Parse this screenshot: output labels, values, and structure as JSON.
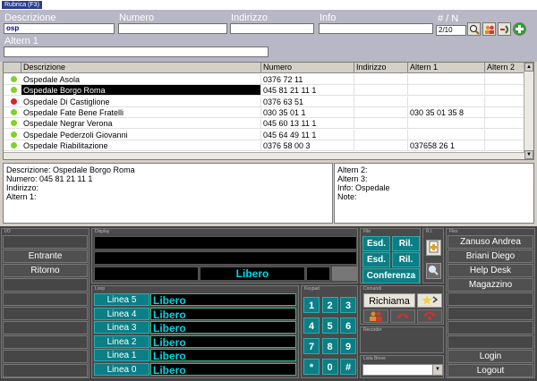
{
  "window": {
    "title": "Rubrica (F3)"
  },
  "search": {
    "desc_label": "Descrizione",
    "desc_value": "osp",
    "numero_label": "Numero",
    "indirizzo_label": "Indirizzo",
    "info_label": "Info",
    "altern_label": "Altern 1",
    "count_label": "# / N",
    "count_value": "2/10"
  },
  "grid": {
    "columns": [
      "Descrizione",
      "Numero",
      "Indirizzo",
      "Altern 1",
      "Altern 2"
    ],
    "rows": [
      {
        "status": "green",
        "desc": "Ospedale Asola",
        "num": "0376 72 11",
        "ind": "",
        "alt1": "",
        "alt2": ""
      },
      {
        "status": "green",
        "desc": "Ospedale Borgo Roma",
        "num": "045 81 21 11 1",
        "ind": "",
        "alt1": "",
        "alt2": ""
      },
      {
        "status": "red",
        "desc": "Ospedale Di Castiglione",
        "num": "0376 63 51",
        "ind": "",
        "alt1": "",
        "alt2": ""
      },
      {
        "status": "green",
        "desc": "Ospedale Fate Bene Fratelli",
        "num": "030 35 01 1",
        "ind": "",
        "alt1": "030 35 01 35 8",
        "alt2": ""
      },
      {
        "status": "green",
        "desc": "Ospedale Negrar Verona",
        "num": "045 60 13 11 1",
        "ind": "",
        "alt1": "",
        "alt2": ""
      },
      {
        "status": "green",
        "desc": "Ospedale Pederzoli Giovanni",
        "num": "045 64 49 11 1",
        "ind": "",
        "alt1": "",
        "alt2": ""
      },
      {
        "status": "green",
        "desc": "Ospedale Riabilitazione",
        "num": "0376 58 00 3",
        "ind": "",
        "alt1": "037658 26 1",
        "alt2": ""
      }
    ]
  },
  "detail": {
    "left": [
      "Descrizione: Ospedale Borgo Roma",
      "Numero: 045 81 21 11 1",
      "Indirizzo:",
      "Altern 1:"
    ],
    "right": [
      "Altern 2:",
      "Altern 3:",
      "Info: Ospedale",
      "Note:"
    ]
  },
  "panel": {
    "io_title": "I/O",
    "display_title": "Display",
    "file_title": "File",
    "ri_title": "R.I.",
    "flex_title": "Flex",
    "loop_title": "Loop",
    "keypad_title": "Keypad",
    "comandi_title": "Comandi",
    "recorder_title": "Recorder",
    "lista_title": "Lista Breve",
    "io_buttons": [
      "",
      "Entrante",
      "Ritorno",
      "",
      "",
      "",
      "",
      "",
      "",
      ""
    ],
    "display_status": "Libero",
    "file_buttons": {
      "esd1": "Esd.",
      "ril1": "Ril.",
      "esd2": "Esd.",
      "ril2": "Ril.",
      "conferenza": "Conferenza"
    },
    "flex_buttons": [
      "Zanuso Andrea",
      "Briani Diego",
      "Help Desk",
      "Magazzino",
      "",
      "",
      "",
      "",
      "Login",
      "Logout"
    ],
    "lines": [
      {
        "label": "Linea 5",
        "status": "Libero"
      },
      {
        "label": "Linea 4",
        "status": "Libero"
      },
      {
        "label": "Linea 3",
        "status": "Libero"
      },
      {
        "label": "Linea 2",
        "status": "Libero"
      },
      {
        "label": "Linea 1",
        "status": "Libero"
      },
      {
        "label": "Linea 0",
        "status": "Libero"
      }
    ],
    "keys": [
      "1",
      "2",
      "3",
      "4",
      "5",
      "6",
      "7",
      "8",
      "9",
      "*",
      "0",
      "#"
    ],
    "richiama": "Richiama"
  },
  "colors": {
    "status_green": "#7fd32a",
    "status_red": "#e0202a",
    "teal": "#0b7e86",
    "libero_text": "#00d6e6"
  }
}
